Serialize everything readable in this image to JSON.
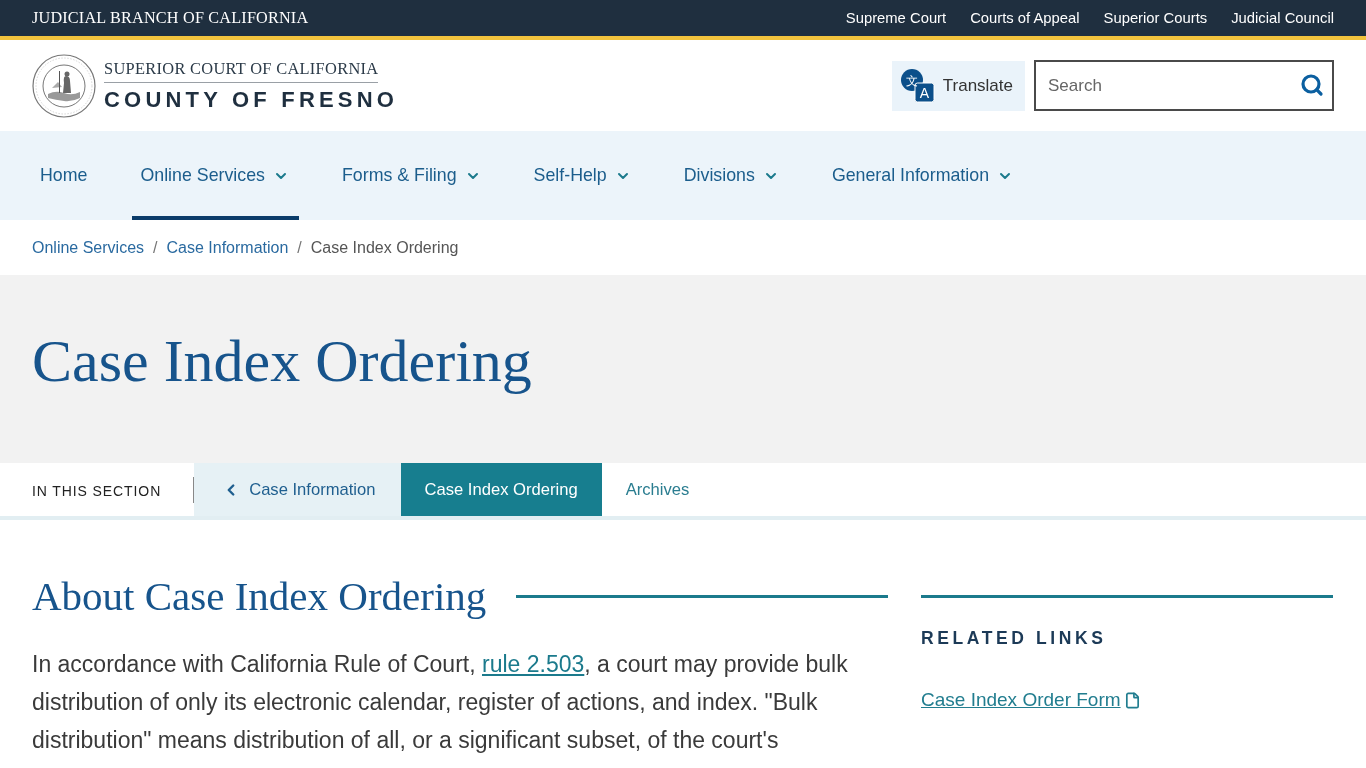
{
  "top_bar": {
    "title": "JUDICIAL BRANCH OF CALIFORNIA",
    "links": [
      "Supreme Court",
      "Courts of Appeal",
      "Superior Courts",
      "Judicial Council"
    ]
  },
  "header": {
    "logo": {
      "line_1": "SUPERIOR COURT OF CALIFORNIA",
      "line_2": "COUNTY OF FRESNO"
    },
    "translate": {
      "label": "Translate",
      "icon_glyphs": [
        "文",
        "A"
      ]
    },
    "search": {
      "placeholder": "Search"
    }
  },
  "main_nav": [
    {
      "label": "Home",
      "has_menu": false,
      "selected": false
    },
    {
      "label": "Online Services",
      "has_menu": true,
      "selected": true
    },
    {
      "label": "Forms & Filing",
      "has_menu": true,
      "selected": false
    },
    {
      "label": "Self-Help",
      "has_menu": true,
      "selected": false
    },
    {
      "label": "Divisions",
      "has_menu": true,
      "selected": false
    },
    {
      "label": "General Information",
      "has_menu": true,
      "selected": false
    }
  ],
  "breadcrumb": {
    "separator": "/",
    "items": [
      {
        "label": "Online Services",
        "kind": "link"
      },
      {
        "label": "Case Information",
        "kind": "link"
      },
      {
        "label": "Case Index Ordering",
        "kind": "current"
      }
    ]
  },
  "page_title": "Case Index Ordering",
  "section_nav": {
    "label": "IN THIS SECTION",
    "items": [
      {
        "label": "Case Information",
        "kind": "parent",
        "selected": false
      },
      {
        "label": "Case Index Ordering",
        "kind": "page",
        "selected": true
      },
      {
        "label": "Archives",
        "kind": "page",
        "selected": false
      }
    ]
  },
  "article": {
    "heading": "About Case Index Ordering",
    "paragraph": {
      "before": "In accordance with California Rule of Court, ",
      "link": "rule 2.503",
      "after": ", a court may provide bulk distribution of only its electronic calendar, register of actions, and index. \"Bulk distribution\" means distribution of all, or a significant subset, of the court's"
    }
  },
  "related_links": {
    "heading": "RELATED LINKS",
    "links": [
      {
        "label": "Case Index Order Form",
        "kind": "file"
      }
    ]
  }
}
